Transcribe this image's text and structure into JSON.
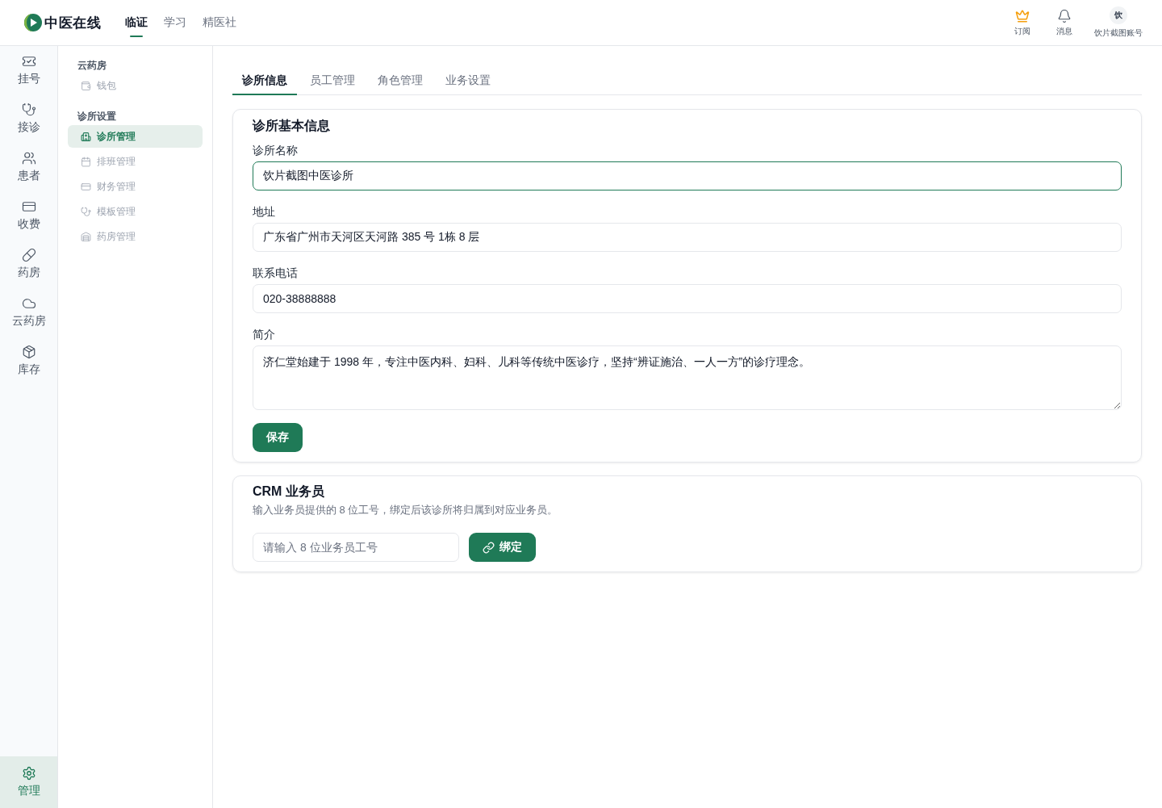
{
  "header": {
    "logo": "中医在线",
    "nav": [
      {
        "label": "临证",
        "selected": true
      },
      {
        "label": "学习",
        "selected": false
      },
      {
        "label": "精医社",
        "selected": false
      }
    ],
    "actions": [
      {
        "kind": "subscribe",
        "label": "订阅"
      },
      {
        "kind": "messages",
        "label": "消息"
      }
    ],
    "account": {
      "avatar": "饮",
      "name": "饮片截图账号"
    }
  },
  "rail": {
    "items": [
      {
        "label": "挂号",
        "selected": false
      },
      {
        "label": "接诊",
        "selected": false
      },
      {
        "label": "患者",
        "selected": false
      },
      {
        "label": "收费",
        "selected": false
      },
      {
        "label": "药房",
        "selected": false
      },
      {
        "label": "云药房",
        "selected": false
      },
      {
        "label": "库存",
        "selected": false
      }
    ],
    "footer_item": {
      "label": "管理",
      "selected": true
    }
  },
  "sidebar": {
    "groups": [
      {
        "title": "云药房",
        "items": [
          {
            "label": "钱包",
            "selected": false
          }
        ]
      },
      {
        "title": "诊所设置",
        "items": [
          {
            "label": "诊所管理",
            "selected": true
          },
          {
            "label": "排班管理",
            "selected": false
          },
          {
            "label": "财务管理",
            "selected": false
          },
          {
            "label": "模板管理",
            "selected": false
          },
          {
            "label": "药房管理",
            "selected": false
          }
        ]
      }
    ]
  },
  "tabs": [
    {
      "label": "诊所信息",
      "selected": true
    },
    {
      "label": "员工管理",
      "selected": false
    },
    {
      "label": "角色管理",
      "selected": false
    },
    {
      "label": "业务设置",
      "selected": false
    }
  ],
  "clinic_info": {
    "title": "诊所基本信息",
    "fields": [
      {
        "kind": "input",
        "label": "诊所名称",
        "value": "饮片截图中医诊所",
        "focused": true
      },
      {
        "kind": "input",
        "label": "地址",
        "value": "广东省广州市天河区天河路 385 号 1栋 8 层",
        "focused": false
      },
      {
        "kind": "input",
        "label": "联系电话",
        "value": "020-38888888",
        "focused": false
      },
      {
        "kind": "textarea",
        "label": "简介",
        "value": "济仁堂始建于 1998 年，专注中医内科、妇科、儿科等传统中医诊疗，坚持“辨证施治、一人一方”的诊疗理念。",
        "focused": false
      }
    ],
    "save_button": "保存"
  },
  "crm": {
    "title": "CRM 业务员",
    "description": "输入业务员提供的 8 位工号，绑定后该诊所将归属到对应业务员。",
    "input": {
      "placeholder": "请输入 8 位业务员工号"
    },
    "bind_button": "绑定"
  }
}
